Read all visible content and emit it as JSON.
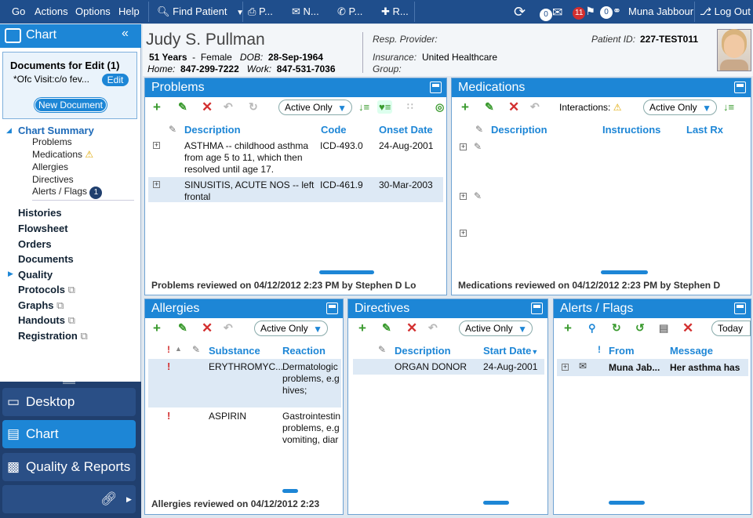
{
  "topbar": {
    "menu": [
      "Go",
      "Actions",
      "Options",
      "Help"
    ],
    "find_patient": "Find Patient",
    "tools": [
      "P...",
      "N...",
      "P...",
      "R..."
    ],
    "mail_count": "0",
    "alerts_count": "11",
    "rx_count": "0",
    "user": "Muna Jabbour",
    "logout": "Log Out"
  },
  "leftnav": {
    "chart_title": "Chart",
    "docs_title": "Documents for Edit (1)",
    "doc_item": "*Ofc Visit:c/o fev...",
    "edit_label": "Edit",
    "new_doc_label": "New Document",
    "chart_summary": "Chart Summary",
    "summary_items": [
      "Problems",
      "Medications",
      "Allergies",
      "Directives",
      "Alerts / Flags"
    ],
    "alerts_badge": "1",
    "sections": [
      "Histories",
      "Flowsheet",
      "Orders",
      "Documents",
      "Quality",
      "Protocols",
      "Graphs",
      "Handouts",
      "Registration"
    ]
  },
  "bottomnav": {
    "desktop": "Desktop",
    "chart": "Chart",
    "quality": "Quality & Reports"
  },
  "patient": {
    "name": "Judy S. Pullman",
    "age": "51 Years",
    "sex": "Female",
    "dob_label": "DOB:",
    "dob": "28-Sep-1964",
    "home_label": "Home:",
    "home": "847-299-7222",
    "work_label": "Work:",
    "work": "847-531-7036",
    "resp_label": "Resp. Provider:",
    "ins_label": "Insurance:",
    "insurance": "United Healthcare",
    "group_label": "Group:",
    "pid_label": "Patient ID:",
    "pid": "227-TEST011"
  },
  "problems": {
    "title": "Problems",
    "filter": "Active Only",
    "columns": [
      "Description",
      "Code",
      "Onset Date"
    ],
    "rows": [
      {
        "desc": "ASTHMA -- childhood asthma from age 5 to 11, which then resolved until age 17.",
        "code": "ICD-493.0",
        "onset": "24-Aug-2001"
      },
      {
        "desc": "SINUSITIS, ACUTE NOS -- left frontal",
        "code": "ICD-461.9",
        "onset": "30-Mar-2003"
      }
    ],
    "footer": "Problems reviewed on 04/12/2012 2:23 PM by Stephen D Lo"
  },
  "medications": {
    "title": "Medications",
    "interactions": "Interactions:",
    "filter": "Active Only",
    "columns": [
      "Description",
      "Instructions",
      "Last Rx"
    ],
    "footer": "Medications reviewed on 04/12/2012 2:23 PM by Stephen D"
  },
  "allergies": {
    "title": "Allergies",
    "filter": "Active Only",
    "columns": [
      "Substance",
      "Reaction"
    ],
    "rows": [
      {
        "substance": "ERYTHROMYC...",
        "reaction": "Dermatologic problems, e.g hives;"
      },
      {
        "substance": "ASPIRIN",
        "reaction": "Gastrointestin problems, e.g vomiting, diar"
      }
    ],
    "footer": "Allergies reviewed on 04/12/2012 2:23"
  },
  "directives": {
    "title": "Directives",
    "filter": "Active Only",
    "columns": [
      "Description",
      "Start Date"
    ],
    "rows": [
      {
        "desc": "ORGAN DONOR",
        "start": "24-Aug-2001"
      }
    ]
  },
  "alerts": {
    "title": "Alerts / Flags",
    "today": "Today",
    "columns": [
      "From",
      "Message"
    ],
    "rows": [
      {
        "from": "Muna Jab...",
        "message": "Her asthma has"
      }
    ]
  },
  "colors": {
    "accent": "#1d86d6",
    "topbar": "#1f4e8c"
  }
}
